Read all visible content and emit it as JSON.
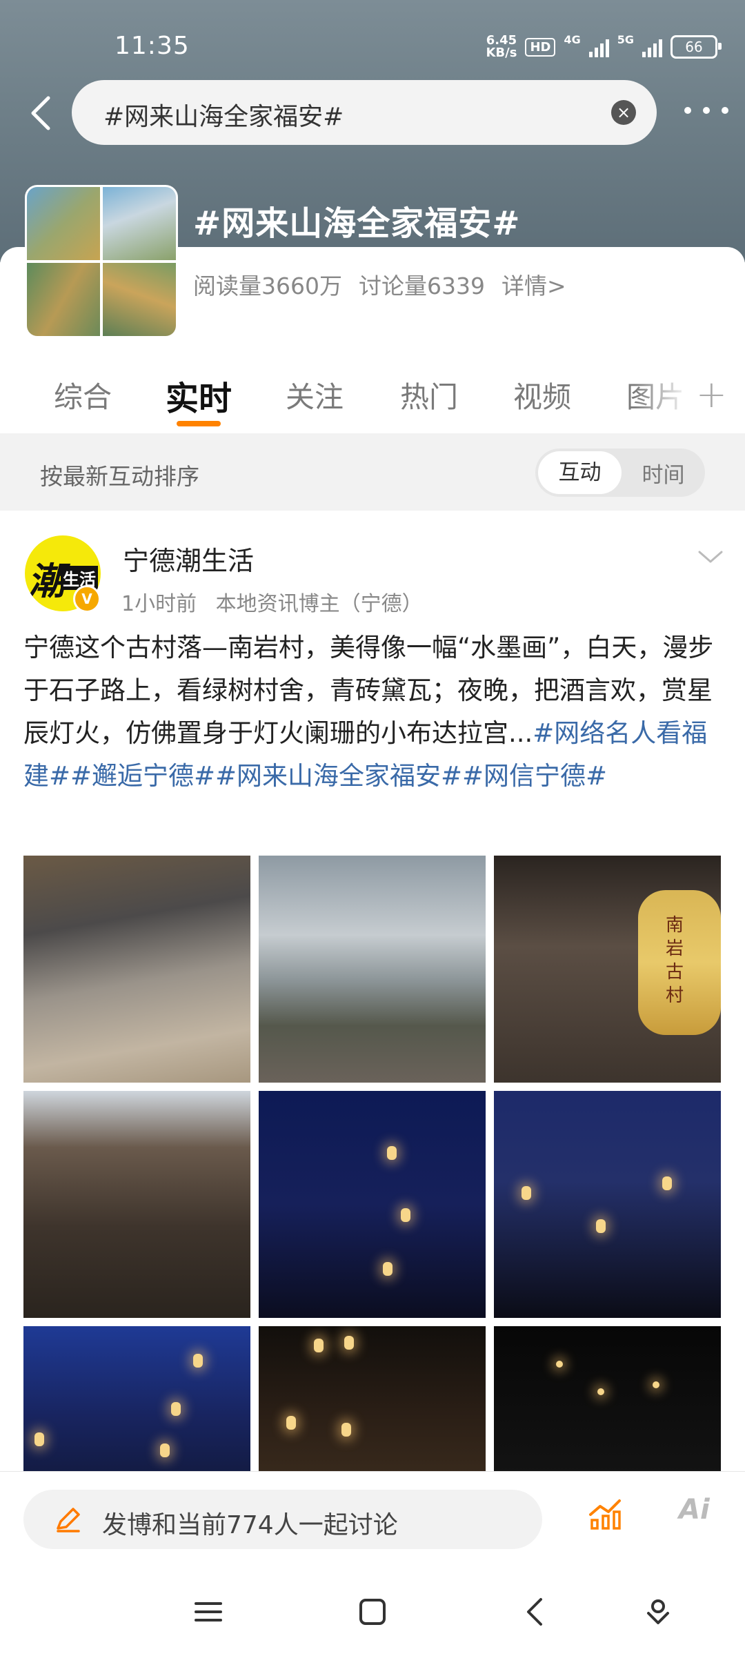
{
  "status": {
    "time": "11:35",
    "speed_value": "6.45",
    "speed_unit": "KB/s",
    "hd_label": "HD",
    "net1": "4G",
    "net2": "5G",
    "battery": "66"
  },
  "search": {
    "query": "#网来山海全家福安#"
  },
  "topic": {
    "title": "#网来山海全家福安#",
    "read_count": "阅读量3660万",
    "discuss_count": "讨论量6339",
    "detail_link": "详情>"
  },
  "tabs": [
    {
      "label": "综合"
    },
    {
      "label": "实时"
    },
    {
      "label": "关注"
    },
    {
      "label": "热门"
    },
    {
      "label": "视频"
    },
    {
      "label": "图片"
    }
  ],
  "sort": {
    "label": "按最新互动排序",
    "option_interact": "互动",
    "option_time": "时间"
  },
  "post": {
    "avatar_text1": "潮",
    "avatar_text2": "生活",
    "author": "宁德潮生活",
    "time": "1小时前",
    "source": "本地资讯博主（宁德）",
    "text_plain": "宁德这个古村落—南岩村，美得像一幅“水墨画”，白天，漫步于石子路上，看绿树村舍，青砖黛瓦；夜晚，把酒言欢，赏星辰灯火，仿佛置身于灯火阑珊的小布达拉宫...",
    "tag1": "#网络名人看福建#",
    "tag2": "#邂逅宁德#",
    "tag3": "#网来山海全家福安#",
    "tag4": "#网信宁德#",
    "lantern_text": "南岩古村"
  },
  "composer": {
    "text": "发博和当前774人一起讨论"
  },
  "ai_label": "Ai"
}
